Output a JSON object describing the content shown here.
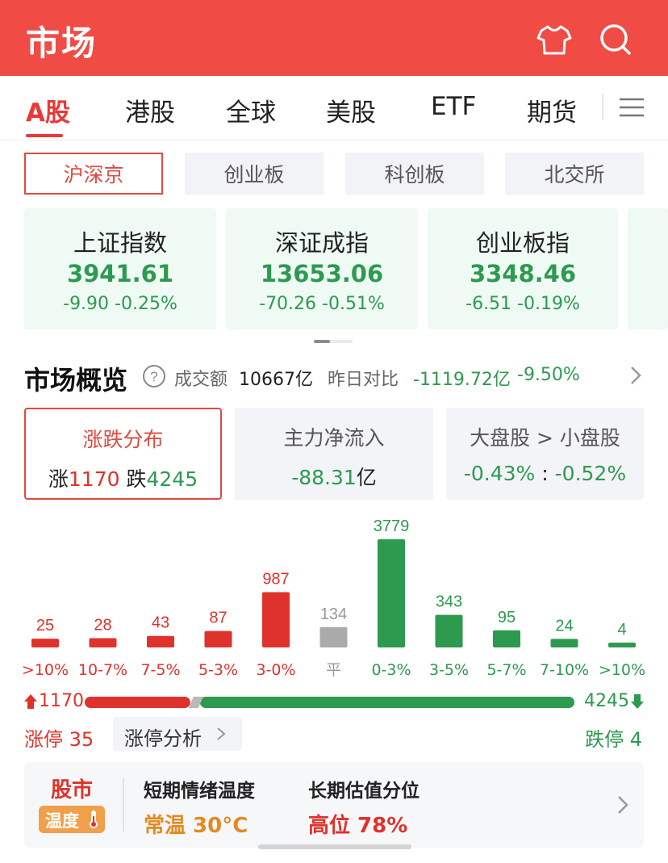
{
  "header": {
    "title": "市场",
    "icons": [
      "tshirt-icon",
      "search-icon"
    ],
    "color": "#f14b45"
  },
  "tabs": [
    {
      "label": "A股",
      "active": true
    },
    {
      "label": "港股",
      "active": false
    },
    {
      "label": "全球",
      "active": false
    },
    {
      "label": "美股",
      "active": false
    },
    {
      "label": "ETF",
      "active": false
    },
    {
      "label": "期货",
      "active": false
    }
  ],
  "sub_tabs": [
    {
      "label": "沪深京",
      "active": true
    },
    {
      "label": "创业板",
      "active": false
    },
    {
      "label": "科创板",
      "active": false
    },
    {
      "label": "北交所",
      "active": false
    }
  ],
  "indices": [
    {
      "name": "上证指数",
      "value": "3941.61",
      "change": "-9.90 -0.25%"
    },
    {
      "name": "深证成指",
      "value": "13653.06",
      "change": "-70.26 -0.51%"
    },
    {
      "name": "创业板指",
      "value": "3348.46",
      "change": "-6.51 -0.19%"
    }
  ],
  "overview": {
    "title": "市场概览",
    "turnover_label": "成交额",
    "turnover_value": "10667亿",
    "compare_label": "昨日对比",
    "compare_value": "-1119.72亿",
    "compare_pct": "-9.50%"
  },
  "stat_cards": {
    "dist": {
      "label": "涨跌分布",
      "up_prefix": "涨",
      "up_value": "1170",
      "down_prefix": "跌",
      "down_value": "4245"
    },
    "flow": {
      "label": "主力净流入",
      "value": "-88.31",
      "unit": "亿"
    },
    "cap": {
      "label": "大盘股 > 小盘股",
      "large": "-0.43%",
      "sep": " : ",
      "small": "-0.52%"
    }
  },
  "chart_data": {
    "type": "bar",
    "categories": [
      ">10%",
      "10-7%",
      "7-5%",
      "5-3%",
      "3-0%",
      "平",
      "0-3%",
      "3-5%",
      "5-7%",
      "7-10%",
      ">10%"
    ],
    "values": [
      25,
      28,
      43,
      87,
      987,
      134,
      3779,
      343,
      95,
      24,
      4
    ],
    "colors": [
      "#e0322c",
      "#e0322c",
      "#e0322c",
      "#e0322c",
      "#e0322c",
      "#aaaaaa",
      "#2d9a50",
      "#2d9a50",
      "#2d9a50",
      "#2d9a50",
      "#2d9a50"
    ]
  },
  "ratio": {
    "up": 1170,
    "down": 4245,
    "up_label": "1170",
    "down_label": "4245"
  },
  "limits": {
    "up_label": "涨停",
    "up_count": "35",
    "analysis_label": "涨停分析",
    "down_label": "跌停",
    "down_count": "4"
  },
  "temperature": {
    "badge_top": "股市",
    "badge_bottom": "温度",
    "short_label": "短期情绪温度",
    "short_value": "常温 30°C",
    "long_label": "长期估值分位",
    "long_value": "高位 78%"
  },
  "colors": {
    "up": "#e0322c",
    "down": "#2d9a50",
    "flat": "#aaaaaa",
    "accent": "#e04a3f"
  }
}
